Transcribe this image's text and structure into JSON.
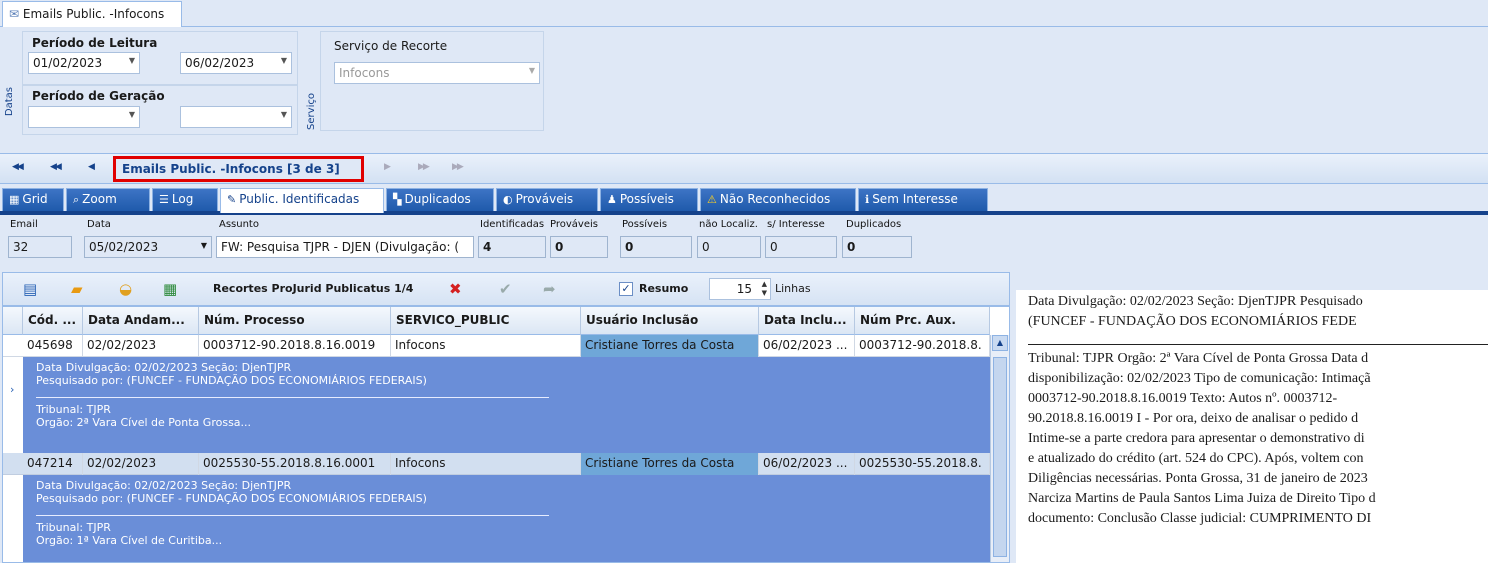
{
  "doc_tab": {
    "label": "Emails Public. -Infocons"
  },
  "filters": {
    "side_label_datas": "Datas",
    "side_label_servico": "Serviço",
    "periodo_leitura": {
      "label": "Período de Leitura",
      "from": "01/02/2023",
      "to": "06/02/2023"
    },
    "periodo_geracao": {
      "label": "Período de Geração",
      "from": "",
      "to": ""
    },
    "servico_recorte": {
      "label": "Serviço de Recorte",
      "value": "Infocons"
    }
  },
  "navigator": {
    "title": "Emails Public. -Infocons [3 de 3]"
  },
  "tabs": [
    {
      "label": "Grid",
      "icon": "grid-icon"
    },
    {
      "label": "Zoom",
      "icon": "zoom-icon"
    },
    {
      "label": "Log",
      "icon": "log-icon"
    },
    {
      "label": "Public. Identificadas",
      "icon": "publications-icon",
      "active": true
    },
    {
      "label": "Duplicados",
      "icon": "duplicates-icon"
    },
    {
      "label": "Prováveis",
      "icon": "probable-icon"
    },
    {
      "label": "Possíveis",
      "icon": "possible-icon"
    },
    {
      "label": "Não Reconhecidos",
      "icon": "warning-icon"
    },
    {
      "label": "Sem Interesse",
      "icon": "no-interest-icon"
    }
  ],
  "info": {
    "email_label": "Email",
    "email": "32",
    "data_label": "Data",
    "data": "05/02/2023",
    "assunto_label": "Assunto",
    "assunto": "FW: Pesquisa TJPR - DJEN (Divulgação: (",
    "identificadas_label": "Identificadas",
    "identificadas": "4",
    "provaveis_label": "Prováveis",
    "provaveis": "0",
    "possiveis_label": "Possíveis",
    "possiveis": "0",
    "nao_localiz_label": "não Localiz.",
    "nao_localiz": "0",
    "s_interesse_label": "s/ Interesse",
    "s_interesse": "0",
    "duplicados_label": "Duplicados",
    "duplicados": "0"
  },
  "grid_toolbar": {
    "title": "Recortes ProJurid Publicatus 1/4",
    "resumo_label": "Resumo",
    "resumo_checked": true,
    "linhas_value": "15",
    "linhas_label": "Linhas"
  },
  "grid": {
    "columns": [
      "Cód. ...",
      "Data Andam...",
      "Núm. Processo",
      "SERVICO_PUBLIC",
      "Usuário Inclusão",
      "Data Inclu...",
      "Núm Prc. Aux."
    ],
    "rows": [
      {
        "cells": [
          "045698",
          "02/02/2023",
          "0003712-90.2018.8.16.0019",
          "Infocons",
          "Cristiane Torres da Costa",
          "06/02/2023 ...",
          "0003712-90.2018.8."
        ],
        "preview": [
          "Data Divulgação: 02/02/2023 Seção: DjenTJPR",
          "Pesquisado por: (FUNCEF - FUNDAÇÃO DOS ECONOMIÁRIOS FEDERAIS)",
          "Tribunal: TJPR",
          "Orgão: 2ª Vara Cível de Ponta Grossa..."
        ]
      },
      {
        "cells": [
          "047214",
          "02/02/2023",
          "0025530-55.2018.8.16.0001",
          "Infocons",
          "Cristiane Torres da Costa",
          "06/02/2023 ...",
          "0025530-55.2018.8."
        ],
        "preview": [
          "Data Divulgação: 02/02/2023 Seção: DjenTJPR",
          "Pesquisado por: (FUNCEF - FUNDAÇÃO DOS ECONOMIÁRIOS FEDERAIS)",
          "Tribunal: TJPR",
          "Orgão: 1ª Vara Cível de Curitiba..."
        ]
      }
    ]
  },
  "detail": {
    "header": [
      "Data Divulgação: 02/02/2023 Seção: DjenTJPR Pesquisado",
      "(FUNCEF - FUNDAÇÃO DOS ECONOMIÁRIOS FEDE"
    ],
    "body": [
      "Tribunal: TJPR Orgão: 2ª Vara Cível de Ponta Grossa Data d",
      "disponibilização: 02/02/2023 Tipo de comunicação: Intimaçã",
      "0003712-90.2018.8.16.0019 Texto: Autos nº. 0003712-",
      "90.2018.8.16.0019 I - Por ora, deixo de analisar o pedido d",
      "Intime-se a parte credora para apresentar o demonstrativo di",
      "e atualizado do crédito (art. 524 do CPC). Após, voltem con",
      "Diligências necessárias. Ponta Grossa, 31 de janeiro de 2023",
      "Narciza Martins de Paula Santos Lima Juiza de Direito Tipo d",
      "documento: Conclusão Classe judicial: CUMPRIMENTO DI"
    ]
  },
  "colors": {
    "accent": "#15428b",
    "tab_blue": "#2a63b5",
    "preview_bg": "#6a8ed8",
    "highlight": "#e00000",
    "user_cell": "#6fa7d8"
  }
}
